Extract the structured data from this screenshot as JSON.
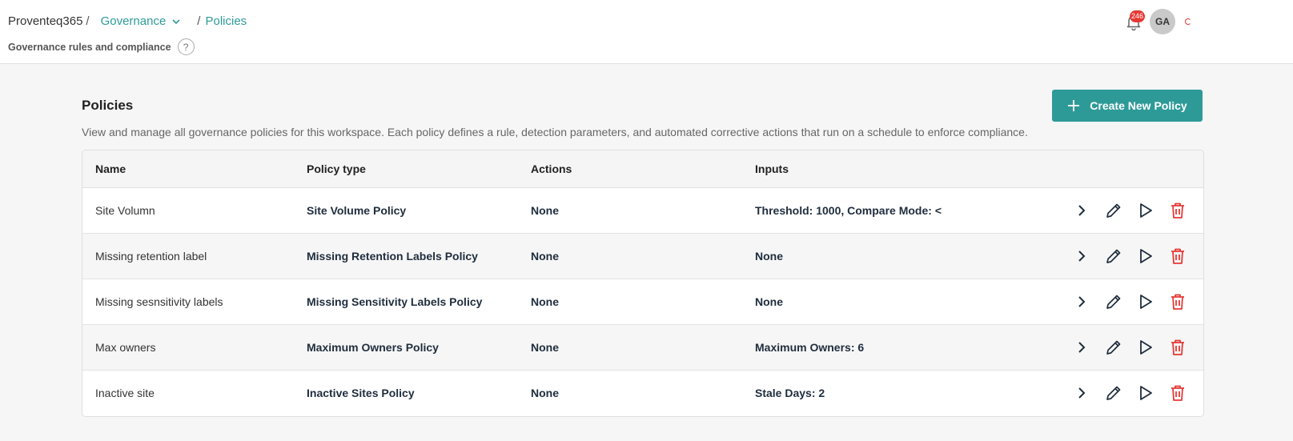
{
  "breadcrumb": {
    "root": "Proventeq365",
    "separator1": "/",
    "section": "Governance",
    "separator2": "/",
    "current": "Policies"
  },
  "header": {
    "subtitle": "Governance rules and compliance",
    "help": "?",
    "notification_count": "246",
    "avatar_initials": "GA"
  },
  "main": {
    "title": "Policies",
    "description": "View and manage all governance policies for this workspace. Each policy defines a rule, detection parameters, and automated corrective actions that run on a schedule to enforce compliance.",
    "create_label": "Create New Policy"
  },
  "table": {
    "columns": [
      "Name",
      "Policy type",
      "Actions",
      "Inputs"
    ],
    "rows": [
      {
        "name": "Site Volumn",
        "type": "Site Volume Policy",
        "actions": "None",
        "inputs": "Threshold: 1000, Compare Mode: <"
      },
      {
        "name": "Missing retention label",
        "type": "Missing Retention Labels Policy",
        "actions": "None",
        "inputs": "None"
      },
      {
        "name": "Missing sesnsitivity labels",
        "type": "Missing Sensitivity Labels Policy",
        "actions": "None",
        "inputs": "None"
      },
      {
        "name": "Max owners",
        "type": "Maximum Owners Policy",
        "actions": "None",
        "inputs": "Maximum Owners: 6"
      },
      {
        "name": "Inactive site",
        "type": "Inactive Sites Policy",
        "actions": "None",
        "inputs": "Stale Days: 2"
      }
    ]
  },
  "row_icons": [
    "chevron-right-icon",
    "pencil-icon",
    "play-icon",
    "trash-icon"
  ],
  "colors": {
    "accent": "#2e9a98",
    "danger": "#e53935",
    "text_dark": "#1f2d3d"
  }
}
